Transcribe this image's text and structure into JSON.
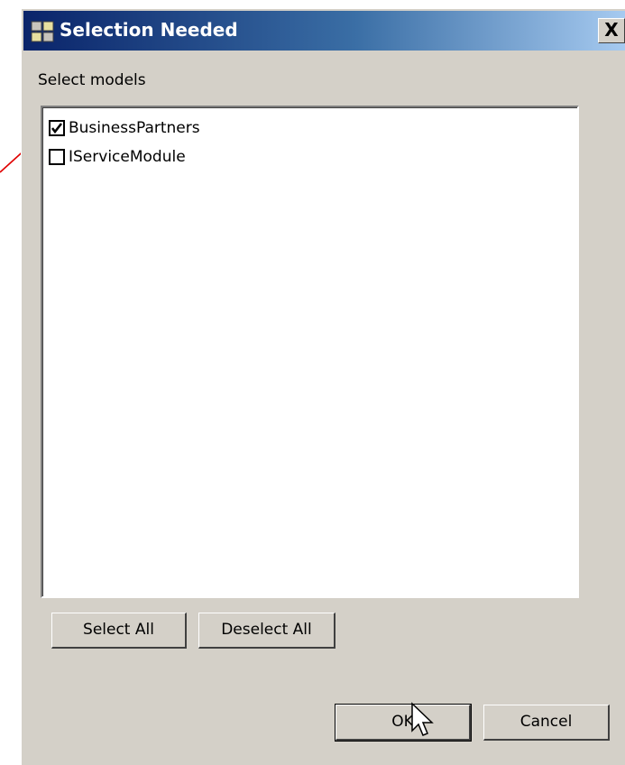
{
  "dialog": {
    "title": "Selection Needed",
    "close_label": "X",
    "title_icon": "app-window-icon",
    "prompt_label": "Select models"
  },
  "models": [
    {
      "label": "BusinessPartners",
      "checked": true
    },
    {
      "label": "IServiceModule",
      "checked": false
    }
  ],
  "buttons": {
    "select_all": "Select All",
    "deselect_all": "Deselect All",
    "ok": "OK",
    "cancel": "Cancel"
  },
  "colors": {
    "titlebar_start": "#0a246a",
    "titlebar_end": "#a6caf0",
    "face": "#d4d0c8",
    "annotation_arrow": "#e00000"
  }
}
